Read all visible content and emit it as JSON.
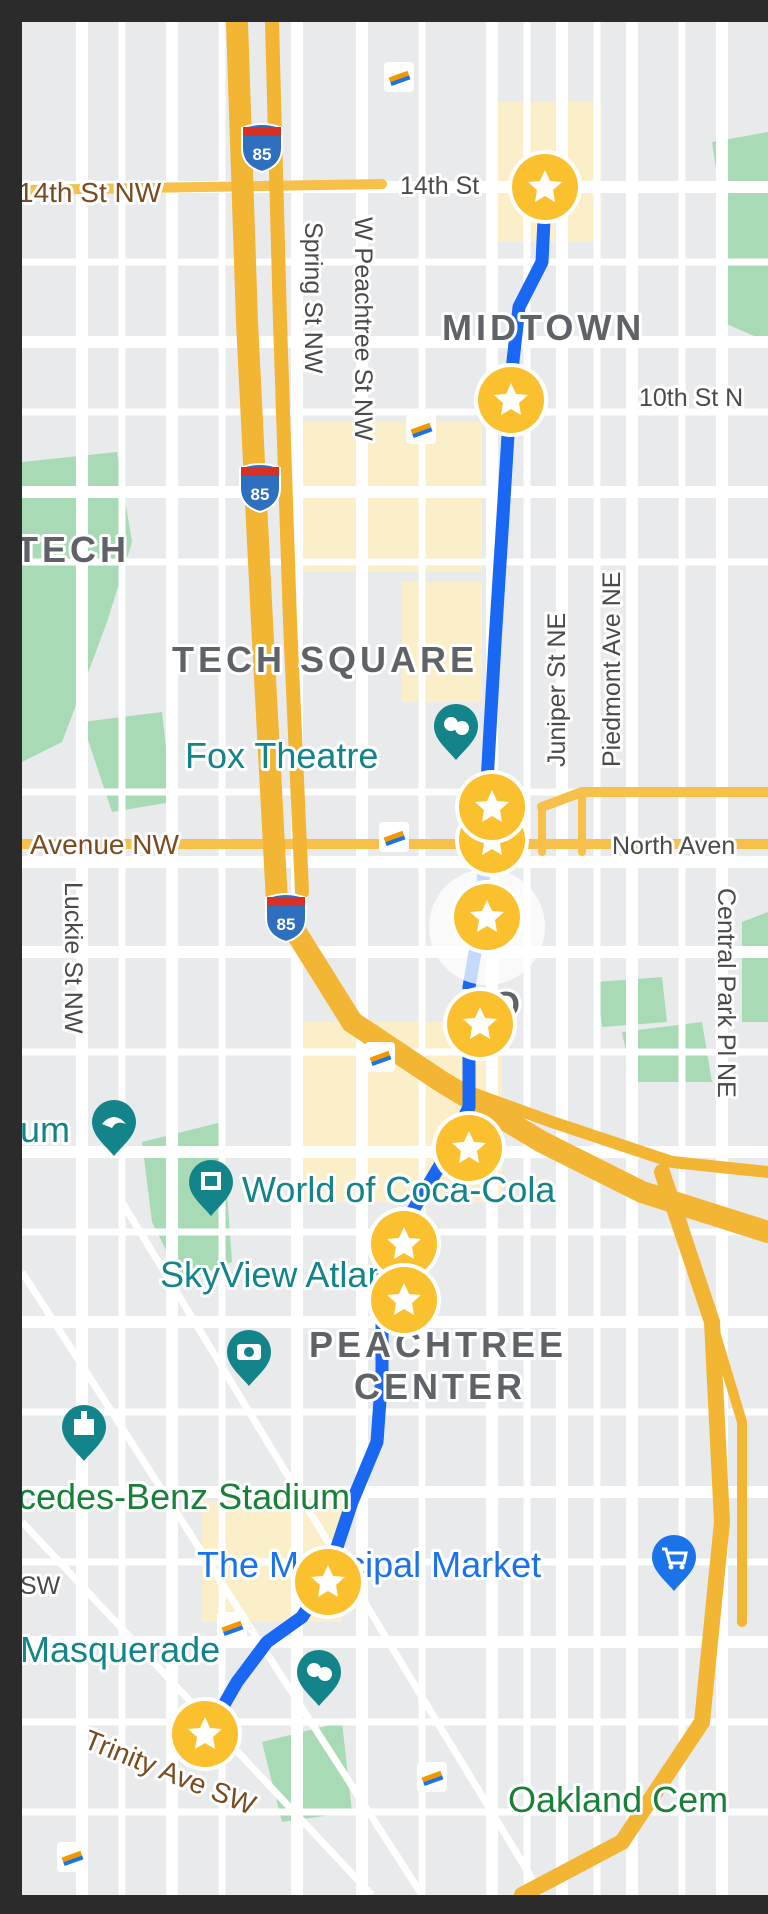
{
  "colors": {
    "route": "#1967f2",
    "marker": "#fbc02d",
    "highway": "#f6c04a",
    "park": "#a8dab5",
    "commercial": "#fbefc9",
    "background": "#e9eaec"
  },
  "districts": {
    "midtown": "MIDTOWN",
    "tech_square": "TECH SQUARE",
    "tech": "TECH",
    "sono": "NO",
    "peachtree_line1": "PEACHTREE",
    "peachtree_line2": "CENTER"
  },
  "streets": {
    "fourteenth_nw": "14th St NW",
    "fourteenth": "14th St",
    "tenth": "10th St N",
    "spring": "Spring St NW",
    "w_peachtree": "W Peachtree St NW",
    "juniper": "Juniper St NE",
    "piedmont": "Piedmont Ave NE",
    "north_ave_nw": "Avenue NW",
    "north_ave": "North Aven",
    "luckie": "Luckie St NW",
    "central_park": "Central Park Pl NE",
    "trinity": "Trinity Ave SW",
    "sw": "SW"
  },
  "pois": {
    "fox_theatre": "Fox Theatre",
    "aquarium": "um",
    "coca_cola": "World of Coca-Cola",
    "skyview": "SkyView Atlanta",
    "mercedes": "cedes-Benz Stadium",
    "municipal_market": "The Municipal Market",
    "masquerade": "Masquerade",
    "oakland": "Oakland Cem"
  },
  "shields": {
    "top": "85",
    "middle": "85",
    "lower": "85"
  },
  "icons": [
    "star-marker-icon",
    "theater-masks-icon",
    "dolphin-icon",
    "museum-icon",
    "camera-icon",
    "shopping-cart-icon",
    "castle-icon",
    "transit-icon",
    "interstate-shield-icon"
  ]
}
